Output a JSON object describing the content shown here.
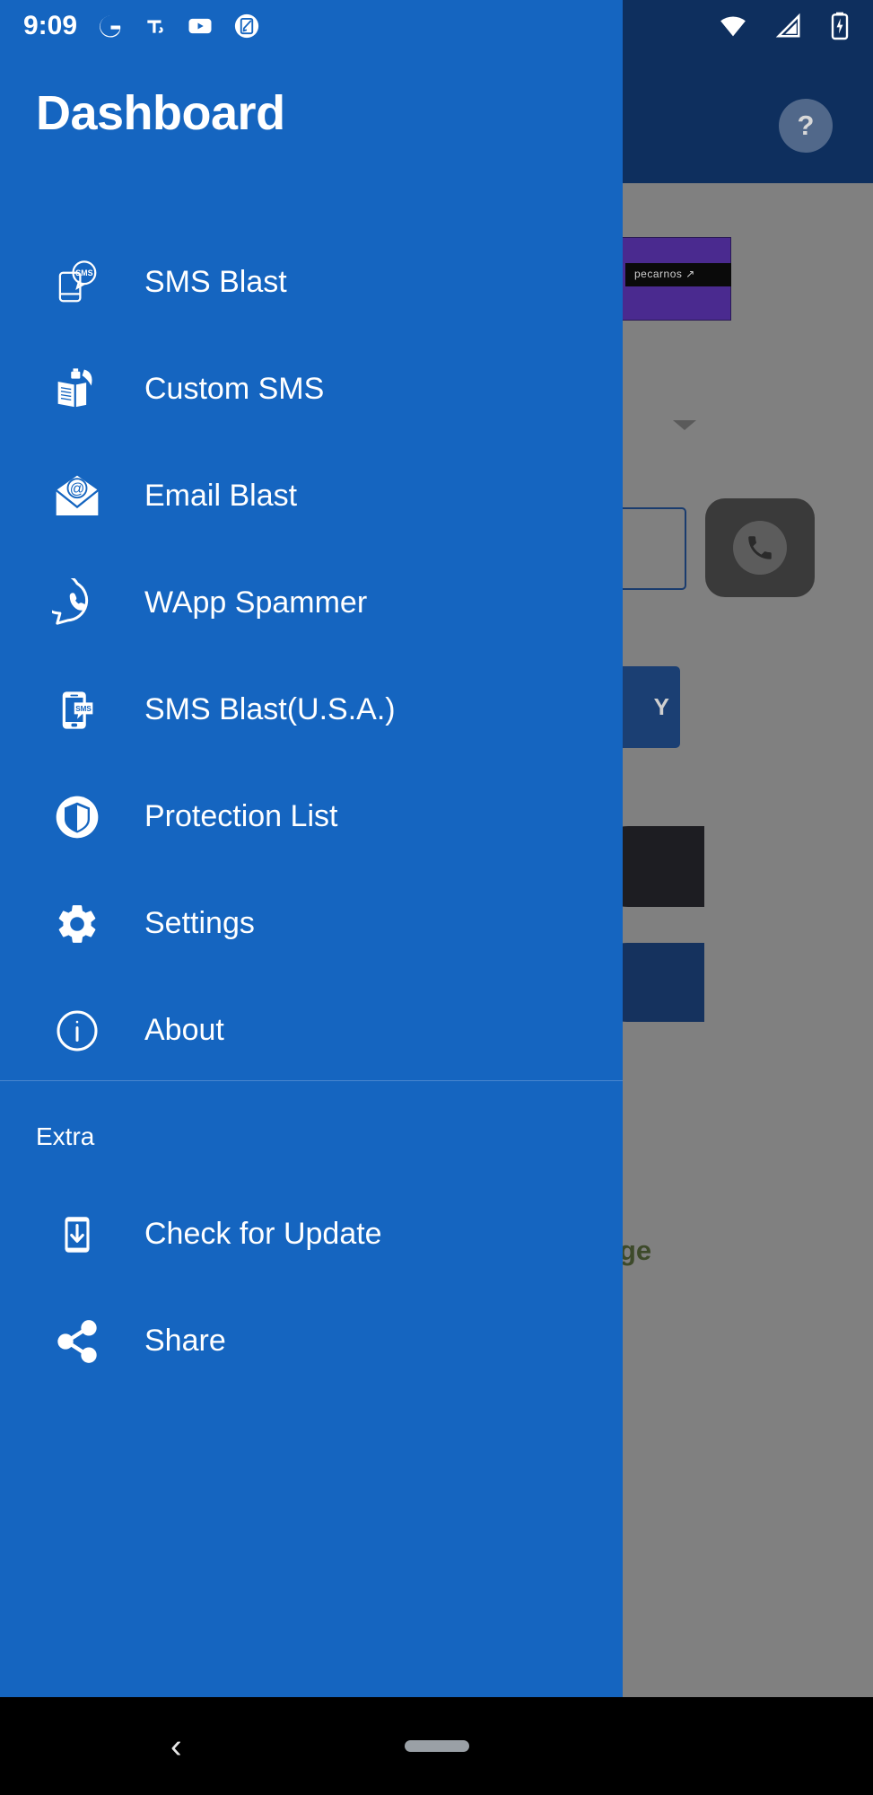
{
  "status_bar": {
    "time": "9:09",
    "left_icons": [
      {
        "name": "google-icon",
        "glyph": "G"
      },
      {
        "name": "grammarly-icon",
        "glyph": "ℳ"
      },
      {
        "name": "youtube-icon",
        "glyph": "▶"
      },
      {
        "name": "screenshot-editor-icon",
        "glyph": "✎"
      }
    ],
    "right_icons": [
      {
        "name": "wifi-icon"
      },
      {
        "name": "cellular-signal-icon"
      },
      {
        "name": "battery-icon"
      }
    ]
  },
  "drawer": {
    "title": "Dashboard",
    "background_color": "#1565c0",
    "items": [
      {
        "label": "SMS Blast",
        "icon": "sms-phone-bubble-icon"
      },
      {
        "label": "Custom SMS",
        "icon": "book-quill-icon"
      },
      {
        "label": "Email Blast",
        "icon": "envelope-at-icon"
      },
      {
        "label": "WApp Spammer",
        "icon": "whatsapp-icon"
      },
      {
        "label": "SMS Blast(U.S.A.)",
        "icon": "phone-sms-icon"
      },
      {
        "label": "Protection List",
        "icon": "shield-circle-icon"
      },
      {
        "label": "Settings",
        "icon": "gear-icon"
      },
      {
        "label": "About",
        "icon": "info-circle-icon"
      }
    ],
    "extra_section": {
      "header": "Extra",
      "items": [
        {
          "label": "Check for Update",
          "icon": "phone-download-icon"
        },
        {
          "label": "Share",
          "icon": "share-icon"
        }
      ]
    }
  },
  "background_app": {
    "appbar_color": "#0e2f5e",
    "help_button": "?",
    "banner_text": "pecarnos ↗",
    "blue_button_label": "Y",
    "green_text": "ge"
  },
  "nav_bar": {
    "back_glyph": "‹",
    "home_pill": ""
  }
}
